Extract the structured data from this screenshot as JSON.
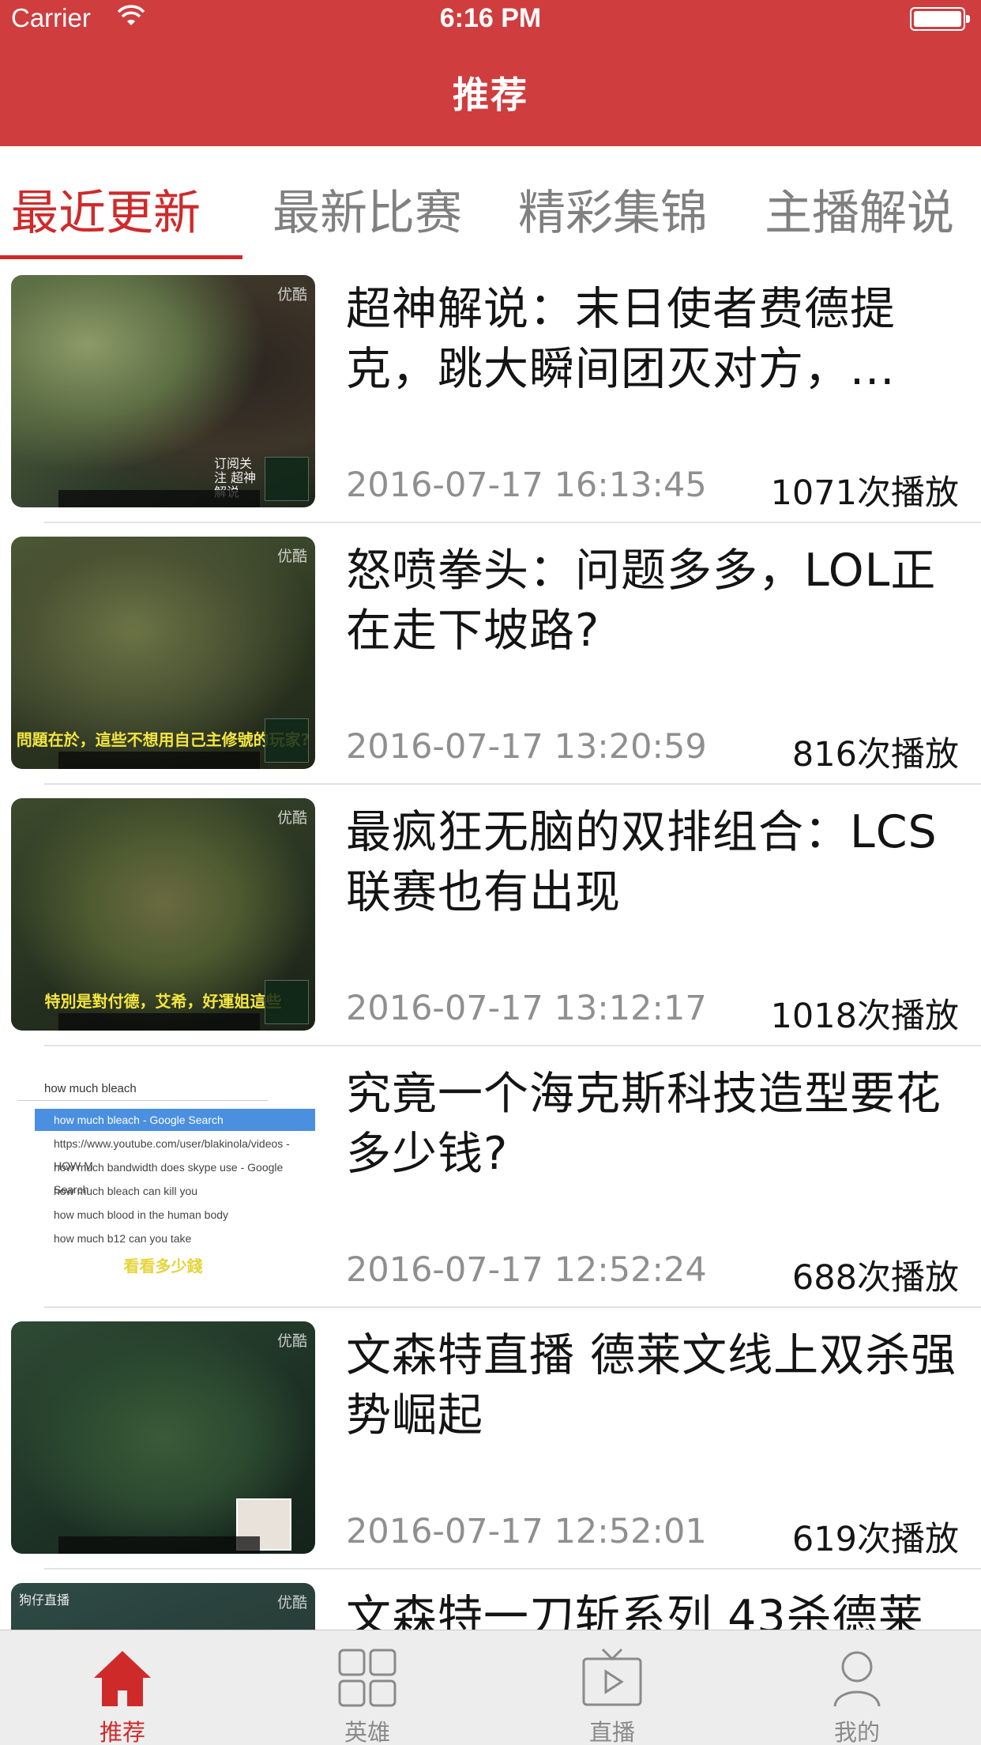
{
  "status_bar": {
    "carrier": "Carrier",
    "time": "6:16 PM"
  },
  "nav": {
    "title": "推荐"
  },
  "categories": [
    {
      "label": "最近更新",
      "active": true
    },
    {
      "label": "最新比赛",
      "active": false
    },
    {
      "label": "精彩集锦",
      "active": false
    },
    {
      "label": "主播解说",
      "active": false
    }
  ],
  "feed": [
    {
      "title": "超神解说：末日使者费德提克，跳大瞬间团灭对方，...",
      "date": "2016-07-17  16:13:45",
      "plays": "1071次播放"
    },
    {
      "title": "怒喷拳头：问题多多，LOL正在走下坡路?",
      "date": "2016-07-17  13:20:59",
      "plays": "816次播放"
    },
    {
      "title": "最疯狂无脑的双排组合：LCS联赛也有出现",
      "date": "2016-07-17  13:12:17",
      "plays": "1018次播放"
    },
    {
      "title": "究竟一个海克斯科技造型要花多少钱?",
      "date": "2016-07-17  12:52:24",
      "plays": "688次播放"
    },
    {
      "title": "文森特直播 德莱文线上双杀强势崛起",
      "date": "2016-07-17  12:52:01",
      "plays": "619次播放"
    },
    {
      "title": "文森特一刀斩系列 43杀德莱",
      "date": "",
      "plays": ""
    }
  ],
  "thumbnails": {
    "badge": "优酷",
    "thumb1_overlay": "订阅关注 超神解说",
    "thumb2_caption": "問題在於，這些不想用自己主修號的玩家?",
    "thumb3_caption": "特別是對付德，艾希，好運姐這些",
    "thumb4_search": "how much bleach",
    "thumb4_suggestions": [
      "how much bleach - Google Search",
      "https://www.youtube.com/user/blakinola/videos - HOW M",
      "how much bandwidth does skype use - Google Search",
      "how much bleach can kill you",
      "how much blood in the human body",
      "how much b12 can you take"
    ],
    "thumb4_caption": "看看多少錢",
    "thumb6_overlay": "狗仔直播"
  },
  "tabbar": [
    {
      "label": "推荐",
      "icon": "home-icon",
      "active": true
    },
    {
      "label": "英雄",
      "icon": "grid-icon",
      "active": false
    },
    {
      "label": "直播",
      "icon": "tv-icon",
      "active": false
    },
    {
      "label": "我的",
      "icon": "person-icon",
      "active": false
    }
  ],
  "colors": {
    "brand_red": "#cf3d3f",
    "active_tab": "#cf2a2a",
    "muted": "#8f8f8f"
  }
}
